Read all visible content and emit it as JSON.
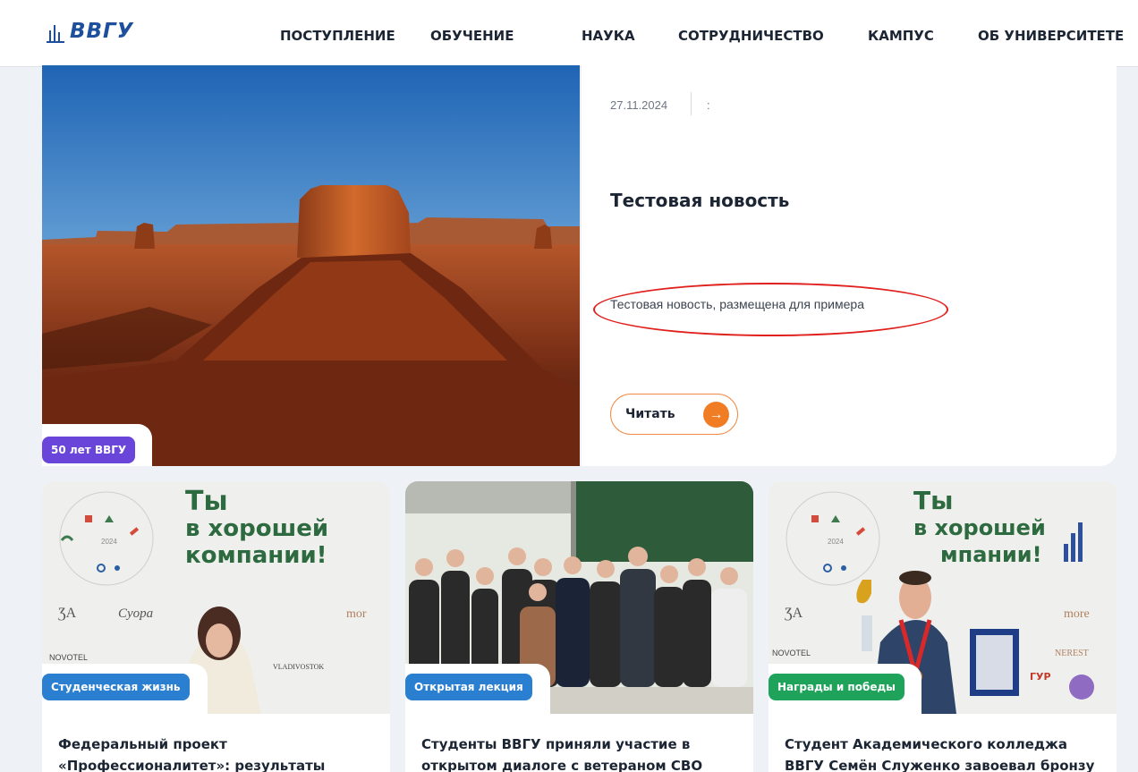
{
  "header": {
    "logo_text": "ВВГУ",
    "nav": [
      "ПОСТУПЛЕНИЕ",
      "ОБУЧЕНИЕ",
      "НАУКА",
      "СОТРУДНИЧЕСТВО",
      "КАМПУС",
      "ОБ УНИВЕРСИТЕТЕ"
    ]
  },
  "hero": {
    "date": "27.11.2024",
    "separator": ":",
    "title": "Тестовая новость",
    "text": "Тестовая новость, размещена для примера",
    "read_label": "Читать",
    "tag": "50 лет ВВГУ"
  },
  "cards": [
    {
      "tag": "Студенческая жизнь",
      "title": "Федеральный проект «Профессионалитет»: результаты",
      "poster": [
        "Ты",
        "в хорошей",
        "компании!"
      ]
    },
    {
      "tag": "Открытая лекция",
      "title": "Студенты ВВГУ приняли участие в открытом диалоге с ветераном СВО"
    },
    {
      "tag": "Награды и победы",
      "title": "Студент Академического колледжа ВВГУ Семён Служенко завоевал бронзу",
      "poster": [
        "Ты",
        "в хорошей",
        "мпании!"
      ]
    }
  ],
  "colors": {
    "accent_orange": "#f07d24",
    "tag_purple": "#6a45d9",
    "tag_blue": "#2a7fd0",
    "tag_green": "#1fa35a",
    "logo_blue": "#1d4f9c"
  }
}
